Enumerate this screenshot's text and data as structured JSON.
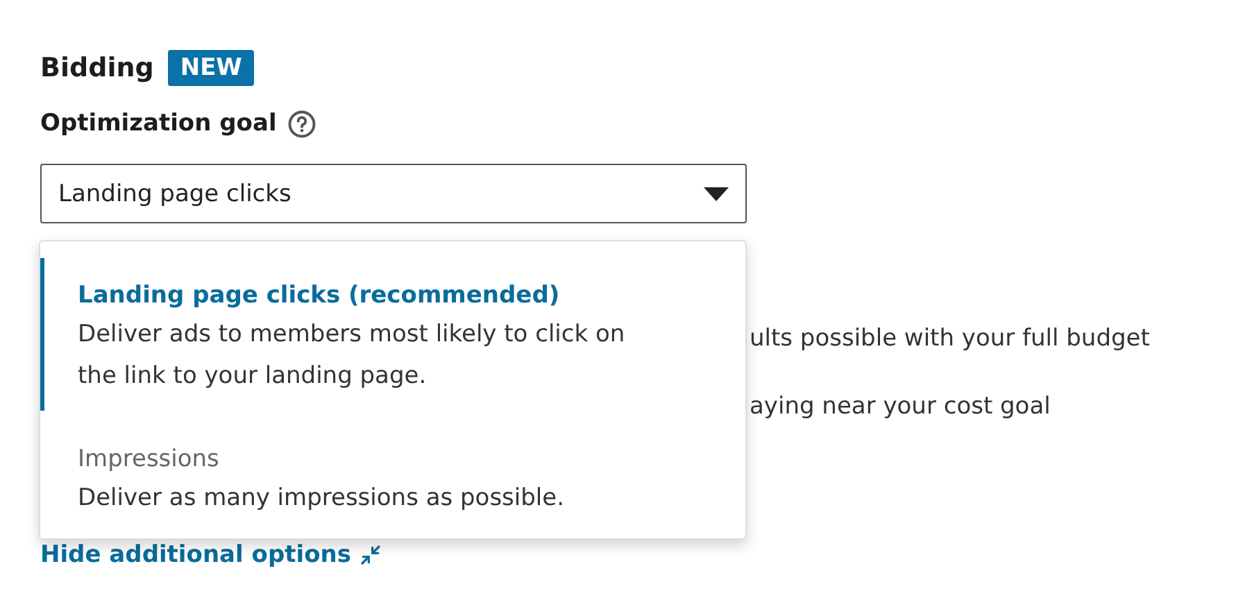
{
  "section": {
    "title": "Bidding",
    "badge": "NEW"
  },
  "optimization_goal": {
    "label": "Optimization goal",
    "value": "Landing page clicks",
    "expanded": true,
    "options": [
      {
        "title": "Landing page clicks (recommended)",
        "description": "Deliver ads to members most likely to click on the link to your landing page.",
        "selected": true
      },
      {
        "title": "Impressions",
        "description": "Deliver as many impressions as possible.",
        "selected": false
      }
    ]
  },
  "background_lines": [
    "ults possible with your full budget",
    "aying near your cost goal"
  ],
  "link": "Hide additional options"
}
